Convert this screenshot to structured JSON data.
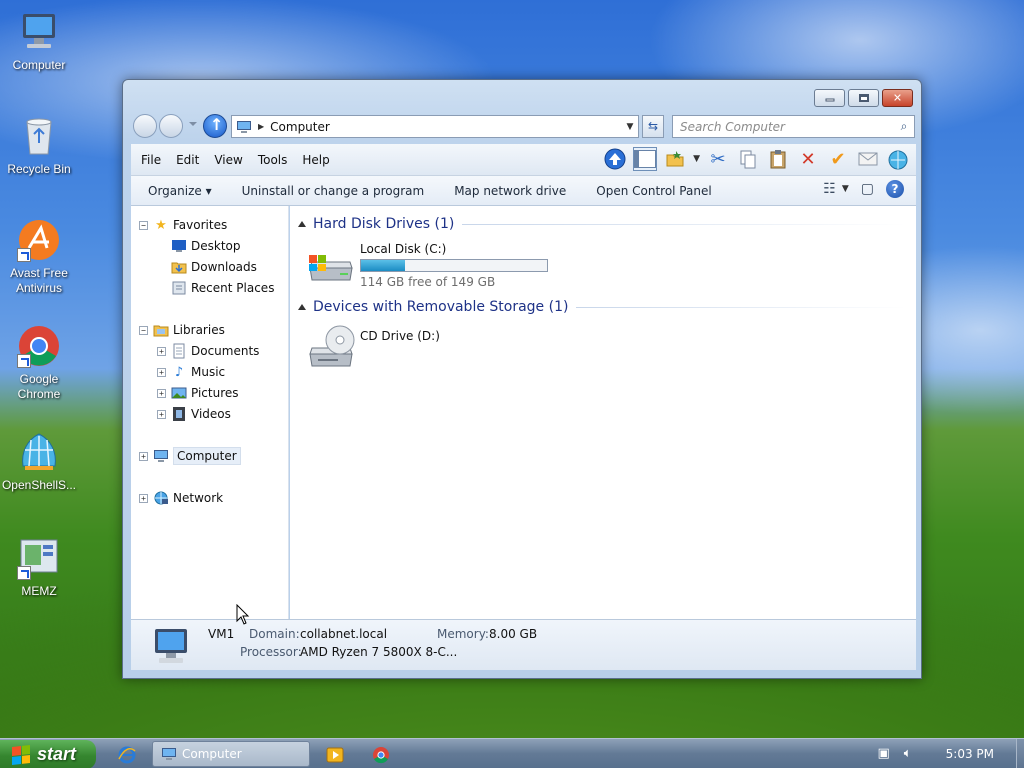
{
  "desktop": {
    "icons": [
      {
        "label": "Computer",
        "icon": "computer-icon"
      },
      {
        "label": "Recycle Bin",
        "icon": "recycle-bin-icon"
      },
      {
        "label": "Avast Free Antivirus",
        "icon": "avast-icon"
      },
      {
        "label": "Google Chrome",
        "icon": "chrome-icon"
      },
      {
        "label": "OpenShellS...",
        "icon": "open-shell-icon"
      },
      {
        "label": "MEMZ",
        "icon": "memz-icon"
      }
    ]
  },
  "window": {
    "title_buttons": [
      "minimize",
      "maximize",
      "close"
    ],
    "address": {
      "location": "Computer"
    },
    "search": {
      "placeholder": "Search Computer"
    },
    "menu": [
      "File",
      "Edit",
      "View",
      "Tools",
      "Help"
    ],
    "commands": [
      "Organize ▾",
      "Uninstall or change a program",
      "Map network drive",
      "Open Control Panel"
    ],
    "nav": {
      "favorites": {
        "label": "Favorites",
        "items": [
          "Desktop",
          "Downloads",
          "Recent Places"
        ]
      },
      "libraries": {
        "label": "Libraries",
        "items": [
          "Documents",
          "Music",
          "Pictures",
          "Videos"
        ]
      },
      "computer": "Computer",
      "network": "Network"
    },
    "groups": {
      "hard_disk": {
        "header": "Hard Disk Drives (1)",
        "drive": {
          "name": "Local Disk (C:)",
          "free_text": "114 GB free of 149 GB",
          "used_fraction": 0.235
        }
      },
      "removable": {
        "header": "Devices with Removable Storage (1)",
        "drive": {
          "name": "CD Drive (D:)"
        }
      }
    },
    "details": {
      "name": "VM1",
      "domain_label": "Domain:",
      "domain": "collabnet.local",
      "memory_label": "Memory:",
      "memory": "8.00 GB",
      "processor_label": "Processor:",
      "processor": "AMD Ryzen 7 5800X 8-C..."
    }
  },
  "taskbar": {
    "start": "start",
    "task": "Computer",
    "clock": "5:03 PM"
  },
  "colors": {
    "accent": "#1e3287",
    "start_green": "#35862f",
    "progress": "#1b8cc3"
  }
}
